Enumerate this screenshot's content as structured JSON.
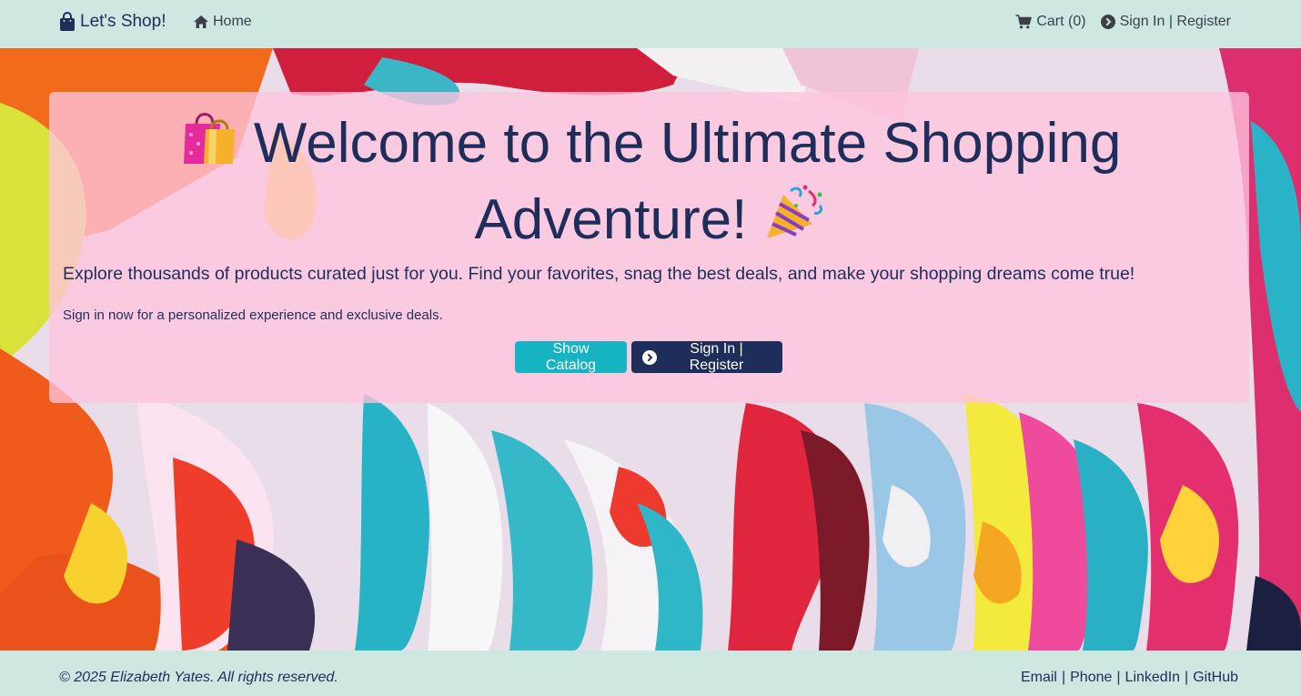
{
  "navbar": {
    "brand": "Let's Shop!",
    "home": "Home",
    "cart": "Cart (0)",
    "signin": "Sign In | Register",
    "icons": {
      "brand": "shopping-bag-icon",
      "home": "home-icon",
      "cart": "cart-icon",
      "signin": "chevron-circle-right-icon"
    }
  },
  "hero": {
    "title_line1": "Welcome to the Ultimate Shopping",
    "title_line2": "Adventure!",
    "emoji_left": "shopping-bags-emoji",
    "emoji_right": "party-popper-emoji",
    "lead": "Explore thousands of products curated just for you. Find your favorites, snag the best deals, and make your shopping dreams come true!",
    "sub": "Sign in now for a personalized experience and exclusive deals.",
    "buttons": {
      "catalog": "Show Catalog",
      "signin": "Sign In | Register"
    }
  },
  "footer": {
    "copyright": "© 2025 Elizabeth Yates. All rights reserved.",
    "links": [
      "Email",
      "Phone",
      "LinkedIn",
      "GitHub"
    ],
    "separator": "|"
  },
  "colors": {
    "nav_bg": "#cce8e1",
    "text": "#1f2d5a",
    "catalog_button": "#16b3c2",
    "signin_button": "#1f2d5a",
    "card_overlay": "#ffc4de"
  }
}
